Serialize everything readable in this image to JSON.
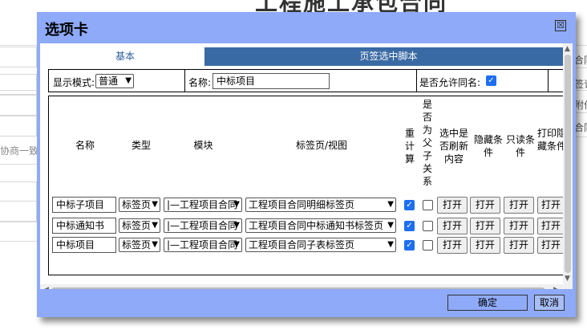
{
  "background": {
    "page_title": "工程施工承包合同",
    "left_text": "协商一致",
    "right_texts": [
      "合同",
      "签订",
      "附件",
      "合同"
    ]
  },
  "dialog": {
    "title": "选项卡",
    "close_label": "☒",
    "tabs": [
      {
        "label": "基本",
        "active": true
      },
      {
        "label": "页签选中脚本",
        "active": false
      }
    ],
    "options": {
      "display_mode_label": "显示模式:",
      "display_mode_value": "普通",
      "name_label": "名称:",
      "name_value": "中标项目",
      "allow_duplicate_label": "是否允许同名:",
      "allow_duplicate": true
    },
    "columns": {
      "name": "名称",
      "type": "类型",
      "module": "模块",
      "tab_view": "标签页/视图",
      "recalc": "重计算",
      "is_parent_child": "是否为父子关系",
      "refresh_on_select": "选中是否刷新内容",
      "hide_condition": "隐藏条件",
      "readonly_condition": "只读条件",
      "print_hide": "打印隐藏条件"
    },
    "rows": [
      {
        "name": "中标子项目",
        "type": "标签页",
        "module": "|—工程项目合同",
        "tab_view": "工程项目合同明细标签页",
        "recalc": true,
        "parent_child": false,
        "btn1": "打开",
        "btn2": "打开",
        "btn3": "打开",
        "btn4": "打开"
      },
      {
        "name": "中标通知书",
        "type": "标签页",
        "module": "|—工程项目合同",
        "tab_view": "工程项目合同中标通知书标签页",
        "recalc": true,
        "parent_child": false,
        "btn1": "打开",
        "btn2": "打开",
        "btn3": "打开",
        "btn4": "打开"
      },
      {
        "name": "中标项目",
        "type": "标签页",
        "module": "|—工程项目合同",
        "tab_view": "工程项目合同子表标签页",
        "recalc": true,
        "parent_child": false,
        "btn1": "打开",
        "btn2": "打开",
        "btn3": "打开",
        "btn4": "打开"
      }
    ],
    "footer": {
      "ok_label": "确定",
      "cancel_label": "取消"
    }
  },
  "colors": {
    "dialog_bg": "#8eaaf8",
    "tab_active_text": "#2b5f9e",
    "tab_inactive_bg": "#3a6aa4",
    "checkbox_blue": "#1d6ef0"
  }
}
